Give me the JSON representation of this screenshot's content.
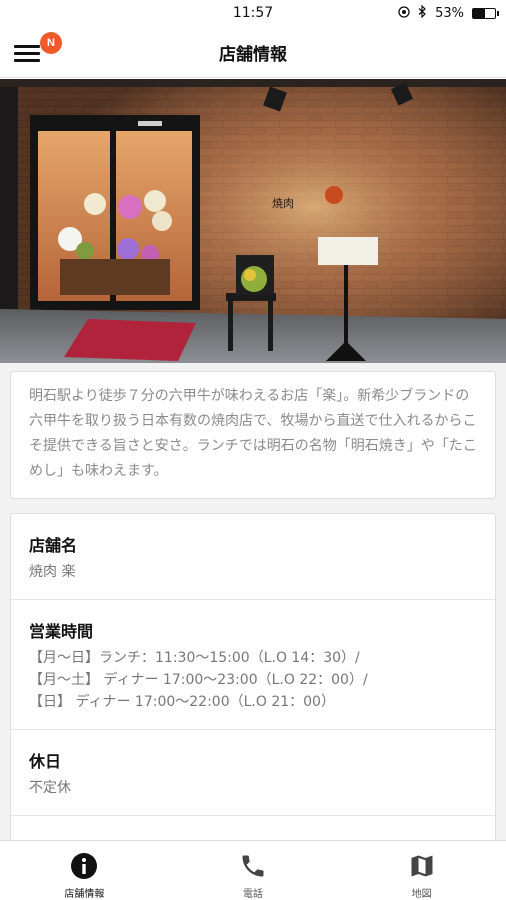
{
  "status_bar": {
    "time": "11:57",
    "battery_text": "53%",
    "battery_level": 0.53
  },
  "nav": {
    "title": "店舗情報",
    "badge": "N",
    "badge_color": "#f05a28"
  },
  "hero": {
    "icon": "storefront-photo"
  },
  "description": "明石駅より徒歩７分の六甲牛が味わえるお店「楽」。新希少ブランドの六甲牛を取り扱う日本有数の焼肉店で、牧場から直送で仕入れるからこそ提供できる旨さと安さ。ランチでは明石の名物「明石焼き」や「たこめし」も味わえます。",
  "info": {
    "name_label": "店舗名",
    "name_value": "焼肉 楽",
    "hours_label": "営業時間",
    "hours_lines": [
      "【月～日】ランチ：11:30～15:00（L.O 14：30）/",
      "【月～土】 ディナー 17:00～23:00（L.O 22：00）/",
      "【日】 ディナー 17:00～22:00（L.O 21：00）"
    ],
    "holiday_label": "休日",
    "holiday_value": "不定休"
  },
  "tabs": [
    {
      "label": "店舗情報",
      "icon": "info-icon",
      "active": true
    },
    {
      "label": "電話",
      "icon": "phone-icon",
      "active": false
    },
    {
      "label": "地図",
      "icon": "map-icon",
      "active": false
    }
  ]
}
